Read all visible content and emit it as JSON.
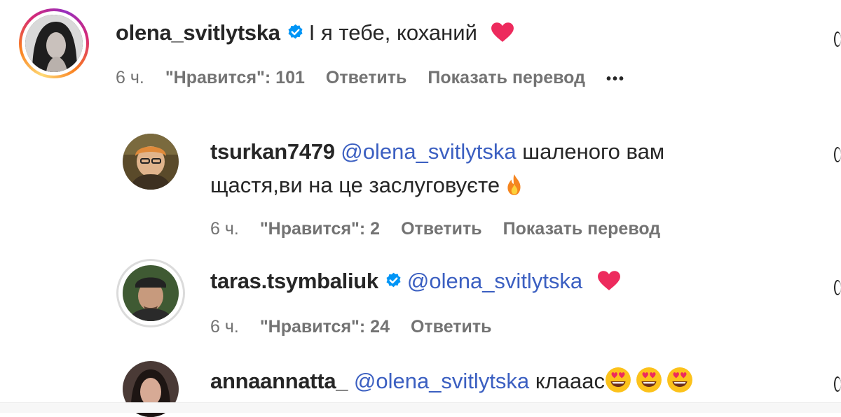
{
  "comments": [
    {
      "username": "olena_svitlytska",
      "verified": true,
      "text": "І я тебе, коханий",
      "emoji": "red-heart",
      "time": "6 ч.",
      "likes": "\"Нравится\": 101",
      "reply": "Ответить",
      "translate": "Показать перевод",
      "more": "•••"
    },
    {
      "username": "tsurkan7479",
      "mention": "@olena_svitlytska",
      "text_line1": "шаленого вам",
      "text_line2": "щастя,ви на це заслуговуєте",
      "emoji": "fire",
      "time": "6 ч.",
      "likes": "\"Нравится\": 2",
      "reply": "Ответить",
      "translate": "Показать перевод"
    },
    {
      "username": "taras.tsymbaliuk",
      "verified": true,
      "mention": "@olena_svitlytska",
      "emoji": "red-heart",
      "time": "6 ч.",
      "likes": "\"Нравится\": 24",
      "reply": "Ответить"
    },
    {
      "username": "annaannatta_",
      "mention": "@olena_svitlytska",
      "text": "клааас",
      "emoji": "heart-eyes x3"
    }
  ],
  "colors": {
    "mention": "#3b5fc1",
    "verified": "#0095f6",
    "meta": "#737373",
    "heart": "#ed2a5d"
  }
}
